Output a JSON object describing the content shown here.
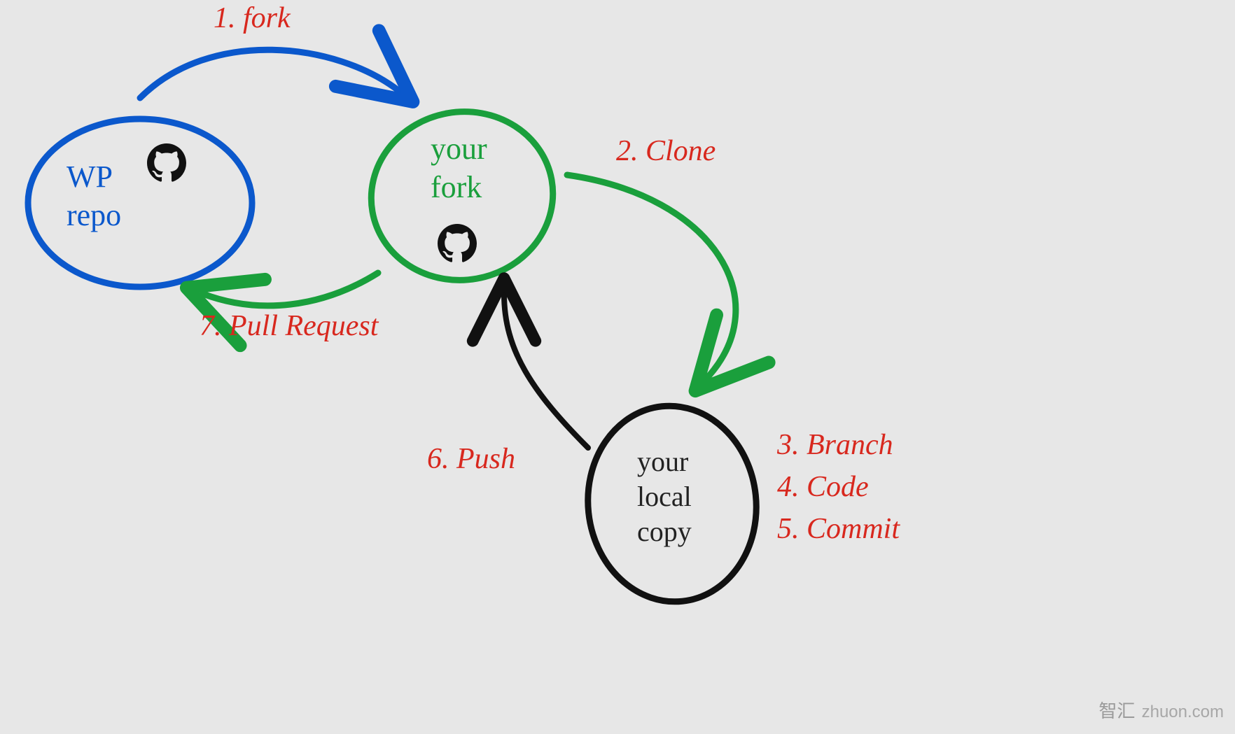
{
  "nodes": {
    "wp_repo": {
      "label": "WP\nrepo"
    },
    "your_fork": {
      "label": "your\nfork"
    },
    "local_copy": {
      "label": "your\nlocal\ncopy"
    }
  },
  "steps": {
    "s1": "1. fork",
    "s2": "2. Clone",
    "s3": "3. Branch",
    "s4": "4. Code",
    "s5": "5. Commit",
    "s6": "6. Push",
    "s7": "7. Pull Request"
  },
  "icons": {
    "github": "github-icon"
  },
  "watermark": {
    "zh": "智汇",
    "domain": "zhuon.com"
  },
  "colors": {
    "blue": "#0b58cc",
    "green": "#1a9f3c",
    "black": "#111111",
    "red": "#d8281e",
    "bg": "#e7e7e7"
  }
}
